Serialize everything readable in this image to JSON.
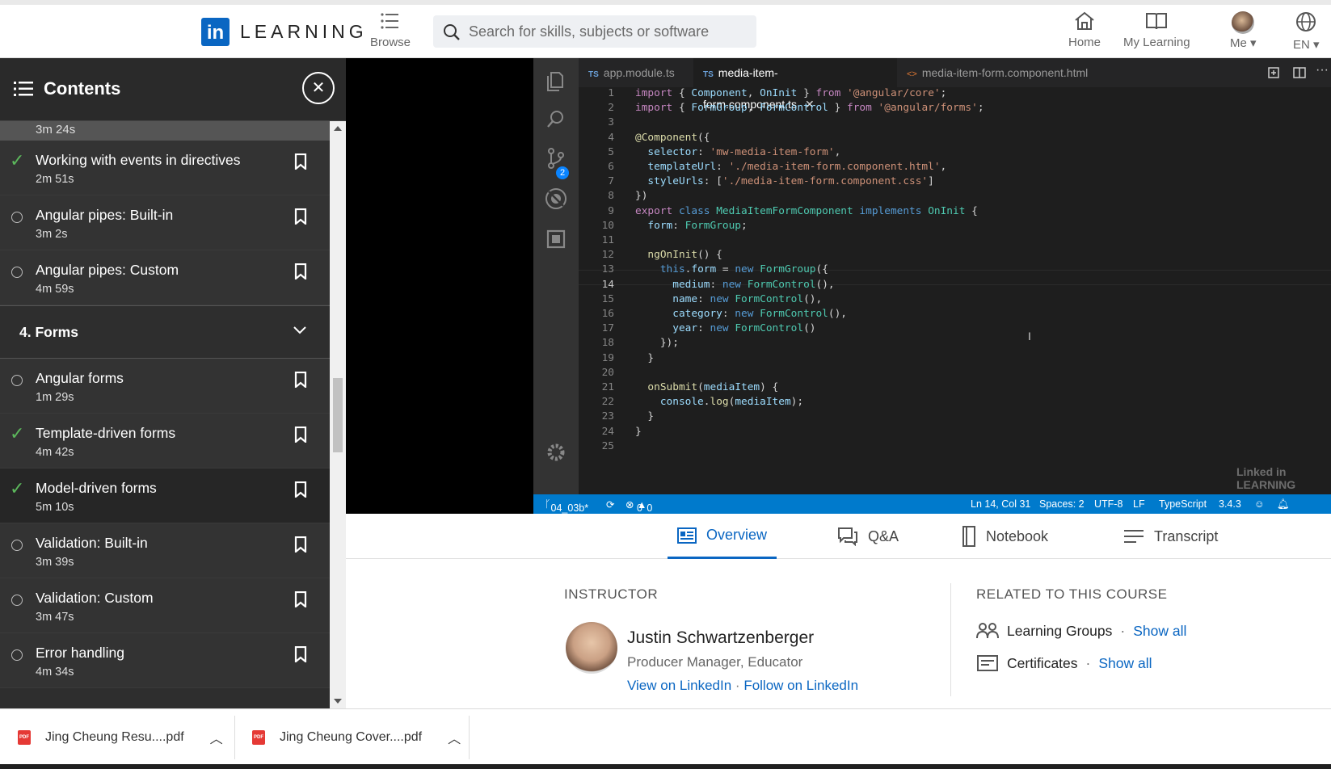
{
  "header": {
    "logo_mark": "in",
    "logo_text": "LEARNING",
    "browse_label": "Browse",
    "search_placeholder": "Search for skills, subjects or software",
    "nav": {
      "home": "Home",
      "my_learning": "My Learning",
      "me": "Me",
      "lang": "EN"
    }
  },
  "sidebar": {
    "title": "Contents",
    "partial_duration": "3m 24s",
    "items_a": [
      {
        "title": "Working with events in directives",
        "duration": "2m 51s",
        "status": "complete"
      },
      {
        "title": "Angular pipes: Built-in",
        "duration": "3m 2s",
        "status": "incomplete"
      },
      {
        "title": "Angular pipes: Custom",
        "duration": "4m 59s",
        "status": "incomplete"
      }
    ],
    "section": "4. Forms",
    "items_b": [
      {
        "title": "Angular forms",
        "duration": "1m 29s",
        "status": "incomplete"
      },
      {
        "title": "Template-driven forms",
        "duration": "4m 42s",
        "status": "complete"
      },
      {
        "title": "Model-driven forms",
        "duration": "5m 10s",
        "status": "complete"
      },
      {
        "title": "Validation: Built-in",
        "duration": "3m 39s",
        "status": "incomplete"
      },
      {
        "title": "Validation: Custom",
        "duration": "3m 47s",
        "status": "incomplete"
      },
      {
        "title": "Error handling",
        "duration": "4m 34s",
        "status": "incomplete"
      }
    ]
  },
  "editor": {
    "tabs": [
      {
        "badge": "TS",
        "label": "app.module.ts"
      },
      {
        "badge": "TS",
        "label": "media-item-form.component.ts"
      },
      {
        "badge": "<>",
        "label": "media-item-form.component.html"
      }
    ],
    "scm_badge": "2",
    "line_numbers": [
      "1",
      "2",
      "3",
      "4",
      "5",
      "6",
      "7",
      "8",
      "9",
      "10",
      "11",
      "12",
      "13",
      "14",
      "15",
      "16",
      "17",
      "18",
      "19",
      "20",
      "21",
      "22",
      "23",
      "24",
      "25"
    ],
    "status": {
      "branch": "04_03b*",
      "problems": "0",
      "warnings": "0",
      "position": "Ln 14, Col 31",
      "spaces": "Spaces: 2",
      "encoding": "UTF-8",
      "eol": "LF",
      "language": "TypeScript",
      "version": "3.4.3"
    },
    "watermark": "Linked in LEARNING"
  },
  "course_tabs": {
    "overview": "Overview",
    "qa": "Q&A",
    "notebook": "Notebook",
    "transcript": "Transcript"
  },
  "instructor": {
    "heading": "INSTRUCTOR",
    "name": "Justin Schwartzenberger",
    "role": "Producer Manager, Educator",
    "view_link": "View on LinkedIn",
    "dot": "·",
    "follow_link": "Follow on LinkedIn"
  },
  "related": {
    "heading": "RELATED TO THIS COURSE",
    "groups_label": "Learning Groups",
    "groups_link": "Show all",
    "certs_label": "Certificates",
    "certs_link": "Show all",
    "dot": "·"
  },
  "downloads": [
    {
      "name": "Jing Cheung Resu....pdf"
    },
    {
      "name": "Jing Cheung Cover....pdf"
    }
  ],
  "colors": {
    "brand": "#0a66c2",
    "sidebar_bg": "#2e2e2e",
    "complete": "#5cb85c",
    "vscode_status": "#007acc"
  }
}
